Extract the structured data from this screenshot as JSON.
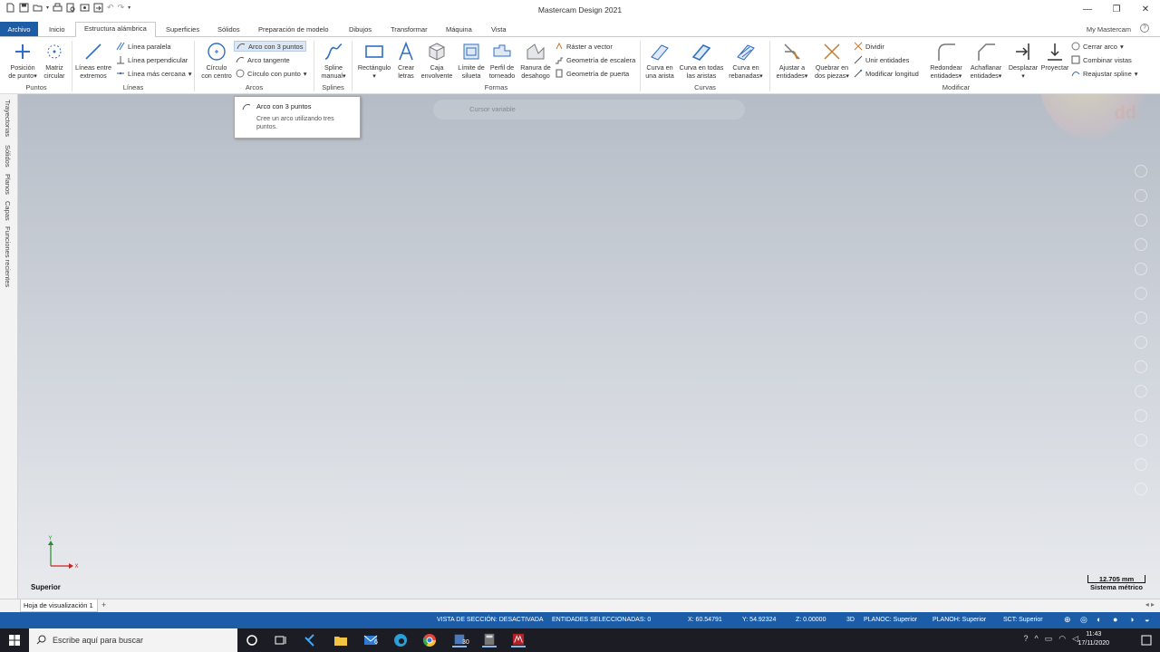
{
  "window": {
    "title": "Mastercam Design 2021",
    "controls": [
      "—",
      "❐",
      "✕"
    ],
    "account_link": "My Mastercam"
  },
  "tabs": [
    {
      "label": "Archivo",
      "file": true
    },
    {
      "label": "Inicio"
    },
    {
      "label": "Estructura alámbrica",
      "active": true
    },
    {
      "label": "Superficies"
    },
    {
      "label": "Sólidos"
    },
    {
      "label": "Preparación de modelo"
    },
    {
      "label": "Dibujos"
    },
    {
      "label": "Transformar"
    },
    {
      "label": "Máquina"
    },
    {
      "label": "Vista"
    }
  ],
  "ribbon": {
    "puntos": {
      "label": "Puntos",
      "posicion_1": "Posición",
      "posicion_2": "de punto",
      "matriz_1": "Matriz",
      "matriz_2": "circular"
    },
    "lineas": {
      "label": "Líneas",
      "entre_1": "Líneas entre",
      "entre_2": "extremos",
      "paralela": "Línea paralela",
      "perpendicular": "Línea perpendicular",
      "cercana": "Línea más cercana"
    },
    "arcos": {
      "label": "Arcos",
      "circulo_1": "Círculo",
      "circulo_2": "con centro",
      "tres_puntos": "Arco con 3 puntos",
      "tangente": "Arco tangente",
      "circulo_punto": "Círculo con punto"
    },
    "splines": {
      "label": "Splines",
      "manual_1": "Spline",
      "manual_2": "manual"
    },
    "formas": {
      "label": "Formas",
      "rectangulo": "Rectángulo",
      "crear_1": "Crear",
      "crear_2": "letras",
      "caja_1": "Caja",
      "caja_2": "envolvente",
      "limite_1": "Límite de",
      "limite_2": "silueta",
      "perfil_1": "Perfil de",
      "perfil_2": "torneado",
      "ranura_1": "Ranura de",
      "ranura_2": "desahogo",
      "raster": "Ráster a vector",
      "escalera": "Geometría de escalera",
      "puerta": "Geometría de puerta"
    },
    "curvas": {
      "label": "Curvas",
      "arista_1": "Curva en",
      "arista_2": "una arista",
      "todas_1": "Curva en todas",
      "todas_2": "las aristas",
      "rebanadas_1": "Curva en",
      "rebanadas_2": "rebanadas"
    },
    "modificar": {
      "label": "Modificar",
      "ajustar_1": "Ajustar a",
      "ajustar_2": "entidades",
      "quebrar_1": "Quebrar en",
      "quebrar_2": "dos piezas",
      "dividir": "Dividir",
      "unir": "Unir entidades",
      "longitud": "Modificar longitud",
      "redondear_1": "Redondear",
      "redondear_2": "entidades",
      "achaflanar_1": "Achaflanar",
      "achaflanar_2": "entidades",
      "desplazar": "Desplazar",
      "proyectar": "Proyectar",
      "cerrar_arco": "Cerrar arco",
      "combinar": "Combinar vistas",
      "reajustar": "Reajustar spline"
    }
  },
  "tooltip": {
    "title": "Arco con 3 puntos",
    "description": "Cree un arco utilizando tres puntos."
  },
  "side_tabs": [
    "Trayectorias",
    "Sólidos",
    "Planos",
    "Capas",
    "Funciones recientes"
  ],
  "viewport": {
    "cursor_bar": "Cursor variable",
    "view_name": "Superior",
    "axis_x": "X",
    "axis_y": "Y",
    "scale_value": "12.705 mm",
    "scale_system": "Sistema métrico",
    "watermark": "dd"
  },
  "sheets": {
    "tab": "Hoja de visualización 1",
    "add": "+"
  },
  "status": {
    "section_view": "VISTA DE SECCIÓN: DESACTIVADA",
    "selected": "ENTIDADES SELECCIONADAS: 0",
    "x": "X:   60.54791",
    "y": "Y:   54.92324",
    "z": "Z:   0.00000",
    "mode": "3D",
    "planoc": "PLANOC: Superior",
    "planoh": "PLANOH: Superior",
    "sct": "SCT: Superior"
  },
  "taskbar": {
    "search_placeholder": "Escribe aquí para buscar",
    "badge_mail": "6",
    "badge_files": "30",
    "time": "11:43",
    "date": "17/11/2020"
  },
  "colors": {
    "accent": "#1d5da8",
    "viewport_top": "#b6bcc6",
    "viewport_bottom": "#e8eaee"
  }
}
